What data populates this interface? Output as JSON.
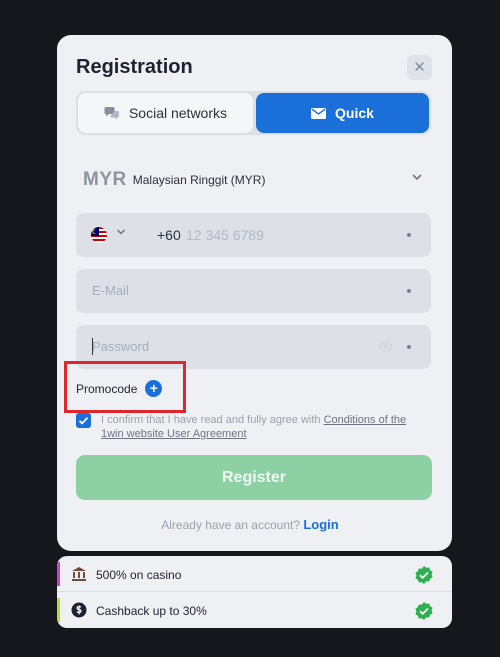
{
  "modal": {
    "title": "Registration",
    "close_glyph": "✕"
  },
  "tabs": [
    {
      "label": "Social networks",
      "icon": "chat-bubbles-icon",
      "active": false
    },
    {
      "label": "Quick",
      "icon": "envelope-icon",
      "active": true
    }
  ],
  "currency": {
    "code": "MYR",
    "name": "Malaysian Ringgit (MYR)"
  },
  "phone": {
    "country_flag": "malaysia-flag-icon",
    "prefix": "+60",
    "placeholder": "12 345 6789"
  },
  "email": {
    "placeholder": "E-Mail"
  },
  "password": {
    "placeholder": "Password"
  },
  "promocode": {
    "label": "Promocode",
    "plus": "+"
  },
  "agreement": {
    "checked": true,
    "text": "I confirm that I have read and fully agree with ",
    "link": "Conditions of the 1win website User Agreement"
  },
  "register": {
    "label": "Register"
  },
  "login": {
    "prompt": "Already have an account?",
    "link": "Login"
  },
  "bonuses": [
    {
      "label": "500% on casino",
      "icon": "casino-icon",
      "accent": "#d93bd1"
    },
    {
      "label": "Cashback up to 30%",
      "icon": "cashback-icon",
      "accent": "#b6e02a"
    }
  ],
  "colors": {
    "primary": "#1a6fd8",
    "register_disabled": "#8dd0a3",
    "check_badge": "#2fb04f",
    "highlight_box": "#e0262d",
    "background": "#16171d"
  }
}
